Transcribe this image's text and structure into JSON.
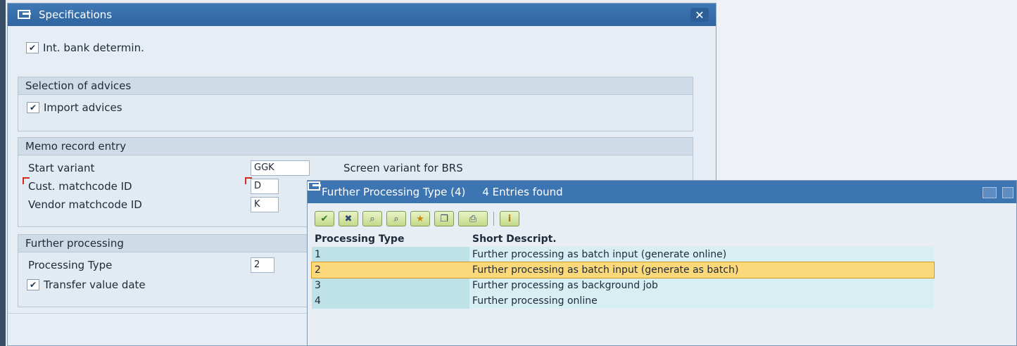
{
  "spec_window": {
    "title": "Specifications",
    "close_label": "✕",
    "int_bank_label": "Int. bank determin.",
    "int_bank_checked": true,
    "selection_group": {
      "title": "Selection of advices",
      "import_label": "Import advices",
      "import_checked": true
    },
    "memo_group": {
      "title": "Memo record entry",
      "start_variant_label": "Start variant",
      "start_variant_value": "GGK",
      "start_variant_desc": "Screen variant for BRS",
      "cust_label": "Cust. matchcode ID",
      "cust_value": "D",
      "vendor_label": "Vendor matchcode ID",
      "vendor_value": "K"
    },
    "further_group": {
      "title": "Further processing",
      "proc_type_label": "Processing Type",
      "proc_type_value": "2",
      "transfer_label": "Transfer value date",
      "transfer_checked": true
    }
  },
  "popup": {
    "title": "Further Processing Type (4)",
    "entries_found": "4 Entries found",
    "columns": [
      "Processing Type",
      "Short Descript."
    ],
    "rows": [
      {
        "type": "1",
        "desc": "Further processing as batch input (generate online)"
      },
      {
        "type": "2",
        "desc": "Further processing as batch input (generate as batch)"
      },
      {
        "type": "3",
        "desc": "Further processing as background job"
      },
      {
        "type": "4",
        "desc": "Further processing online"
      }
    ],
    "selected_row": "2",
    "toolbar": [
      {
        "name": "accept-check-icon",
        "glyph": "✔"
      },
      {
        "name": "cancel-icon",
        "glyph": "✖"
      },
      {
        "name": "find-icon",
        "glyph": "⌕"
      },
      {
        "name": "find-next-icon",
        "glyph": "⌕"
      },
      {
        "name": "favorites-icon",
        "glyph": "★"
      },
      {
        "name": "copy-icon",
        "glyph": "❐"
      },
      {
        "name": "print-icon",
        "glyph": "⎙"
      },
      {
        "name": "info-icon",
        "glyph": "i"
      }
    ]
  },
  "colors": {
    "title_bar": "#3f79b5",
    "selected_row": "#fbd87a",
    "list_row": "#d7eef3"
  }
}
